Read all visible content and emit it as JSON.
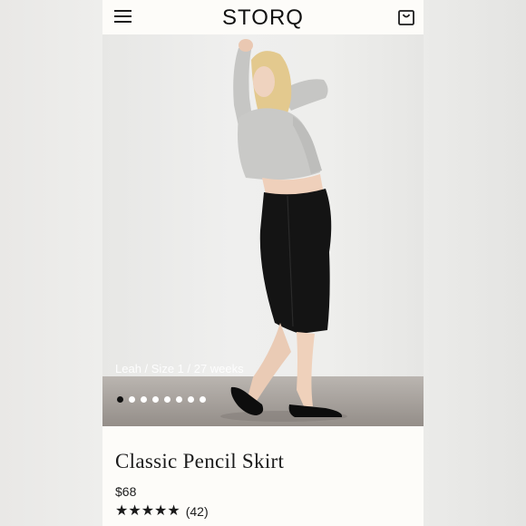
{
  "header": {
    "brand": "STORQ",
    "menu_icon": "hamburger-menu-icon",
    "bag_icon": "shopping-bag-icon"
  },
  "hero": {
    "caption": "Leah / Size 1 / 27 weeks",
    "dots_total": 8,
    "active_dot": 1
  },
  "product": {
    "title": "Classic Pencil Skirt",
    "price": "$68",
    "rating_stars": 5,
    "review_count": "(42)"
  },
  "colors": {
    "page_bg": "#fdfcf9",
    "text": "#1c1c1c",
    "sweater": "#c9c9c7",
    "skirt": "#141414"
  }
}
